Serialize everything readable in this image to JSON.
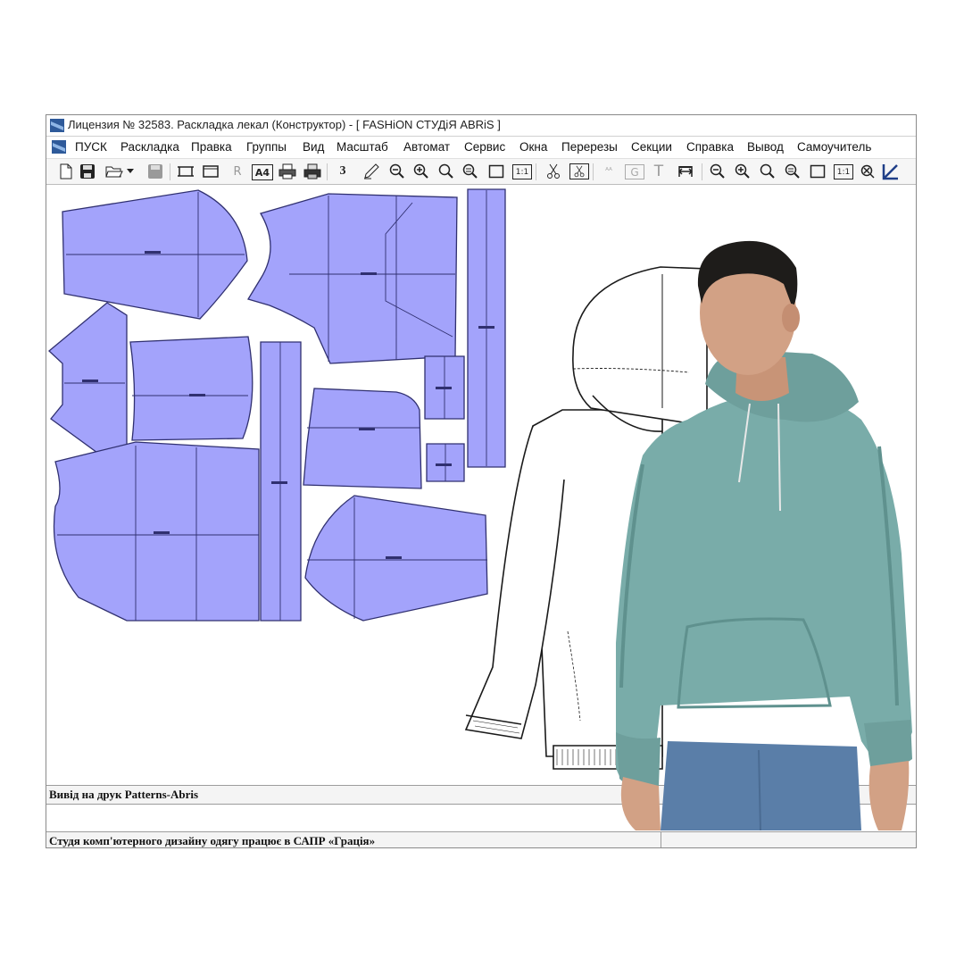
{
  "window": {
    "title": "Лицензия № 32583. Раскладка лекал (Конструктор) - [  FASHiON СТУДiЯ ABRiS  ]"
  },
  "menu": {
    "items": [
      "ПУСК",
      "Раскладка",
      "Правка",
      "Группы",
      "Вид",
      "Масштаб",
      "Автомат",
      "Сервис",
      "Окна",
      "Перерезы",
      "Секции",
      "Справка",
      "Вывод",
      "Самоучитель"
    ]
  },
  "toolbar": {
    "buttons": [
      {
        "icon": "new-file-icon"
      },
      {
        "icon": "save-disk-icon"
      },
      {
        "icon": "open-folder-icon"
      },
      {
        "icon": "dropdown-arrow-icon"
      },
      {
        "icon": "save-disabled-icon"
      },
      {
        "icon": "frame-icon"
      },
      {
        "icon": "frame-wide-icon"
      },
      {
        "icon": "r-icon",
        "label": "R"
      },
      {
        "icon": "a4-icon",
        "label": "A4"
      },
      {
        "icon": "printer-icon"
      },
      {
        "icon": "printer-color-icon"
      },
      {
        "icon": "three-icon",
        "label": "3"
      },
      {
        "icon": "pen-icon"
      },
      {
        "icon": "zoom-out-icon"
      },
      {
        "icon": "zoom-in-icon"
      },
      {
        "icon": "zoom-icon"
      },
      {
        "icon": "zoom-equal-icon"
      },
      {
        "icon": "rectangle-icon"
      },
      {
        "icon": "one-to-one-icon",
        "label": "1:1"
      },
      {
        "icon": "scissors-icon"
      },
      {
        "icon": "scissors-box-icon"
      },
      {
        "icon": "text-style-icon"
      },
      {
        "icon": "g-icon",
        "label": "G"
      },
      {
        "icon": "t-icon",
        "label": "T"
      },
      {
        "icon": "width-icon"
      },
      {
        "icon": "zoom-out-2-icon"
      },
      {
        "icon": "zoom-in-2-icon"
      },
      {
        "icon": "zoom-2-icon"
      },
      {
        "icon": "zoom-equal-2-icon"
      },
      {
        "icon": "rectangle-2-icon"
      },
      {
        "icon": "one-to-one-2-icon",
        "label": "1:1"
      },
      {
        "icon": "zoom-x-icon"
      },
      {
        "icon": "angle-icon"
      }
    ]
  },
  "status": {
    "line1": "Вивід на друк Patterns-Abris",
    "line2": "",
    "line3": "Студя  комп'ютерного дизайну одягу працює в САПР «Грація»"
  },
  "colors": {
    "pattern_fill": "#a3a3fb",
    "pattern_stroke": "#303070",
    "hoodie": "#79aca9",
    "hoodie_shadow": "#5f918e",
    "jeans": "#5a7ea8",
    "skin": "#d2a185",
    "hair": "#1e1c1a"
  }
}
